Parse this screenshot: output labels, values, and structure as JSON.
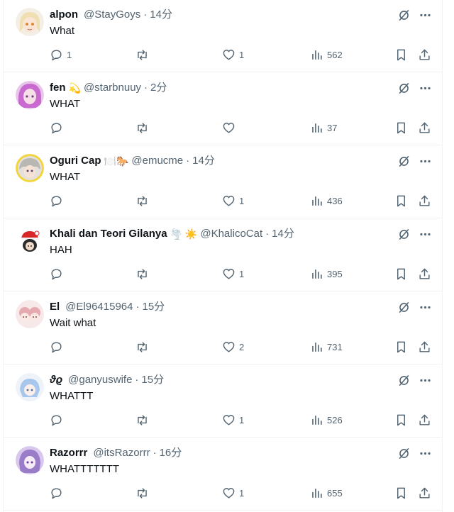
{
  "colors": {
    "text_primary": "#0f1419",
    "text_secondary": "#536471",
    "divider": "#eff3f4"
  },
  "tweets": [
    {
      "name": "alpon",
      "emojis": "",
      "handle": "@StayGoys",
      "separator": "·",
      "time": "14分",
      "text": "What",
      "replies": "1",
      "retweets": "",
      "likes": "1",
      "views": "562",
      "avatar": "anime-girl-blonde"
    },
    {
      "name": "fen",
      "emojis": "💫",
      "handle": "@starbnuuy",
      "separator": "·",
      "time": "2分",
      "text": "WHAT",
      "replies": "",
      "retweets": "",
      "likes": "",
      "views": "37",
      "avatar": "anime-pink-hair"
    },
    {
      "name": "Oguri Cap",
      "emojis": "🍽️🐎",
      "handle": "@emucme",
      "separator": "·",
      "time": "14分",
      "text": "WHAT",
      "replies": "",
      "retweets": "",
      "likes": "1",
      "views": "436",
      "avatar": "anime-grey-hair-yellow-ring"
    },
    {
      "name": "Khali dan Teori Gilanya",
      "emojis": "🌪️ ☀️",
      "handle": "@KhalicoCat",
      "separator": "·",
      "time": "14分",
      "text": "HAH",
      "replies": "",
      "retweets": "",
      "likes": "1",
      "views": "395",
      "avatar": "chibi-red-hat"
    },
    {
      "name": "El",
      "emojis": "",
      "handle": "@El96415964",
      "separator": "·",
      "time": "15分",
      "text": "Wait what",
      "replies": "",
      "retweets": "",
      "likes": "2",
      "views": "731",
      "avatar": "chibi-pink-duo"
    },
    {
      "name": "ϑϱ",
      "emojis": "",
      "handle": "@ganyuswife",
      "separator": "·",
      "time": "15分",
      "text": "WHATTT",
      "replies": "",
      "retweets": "",
      "likes": "1",
      "views": "526",
      "avatar": "chibi-blue-hair"
    },
    {
      "name": "Razorrr",
      "emojis": "",
      "handle": "@itsRazorrr",
      "separator": "·",
      "time": "16分",
      "text": "WHATTTTTTT",
      "replies": "",
      "retweets": "",
      "likes": "1",
      "views": "655",
      "avatar": "anime-purple-hair"
    }
  ],
  "icons": {
    "grok": "grok-slash-icon",
    "more": "more-dots-icon",
    "reply": "reply-bubble-icon",
    "retweet": "retweet-icon",
    "like": "heart-icon",
    "views": "views-bars-icon",
    "bookmark": "bookmark-icon",
    "share": "share-upload-icon"
  }
}
